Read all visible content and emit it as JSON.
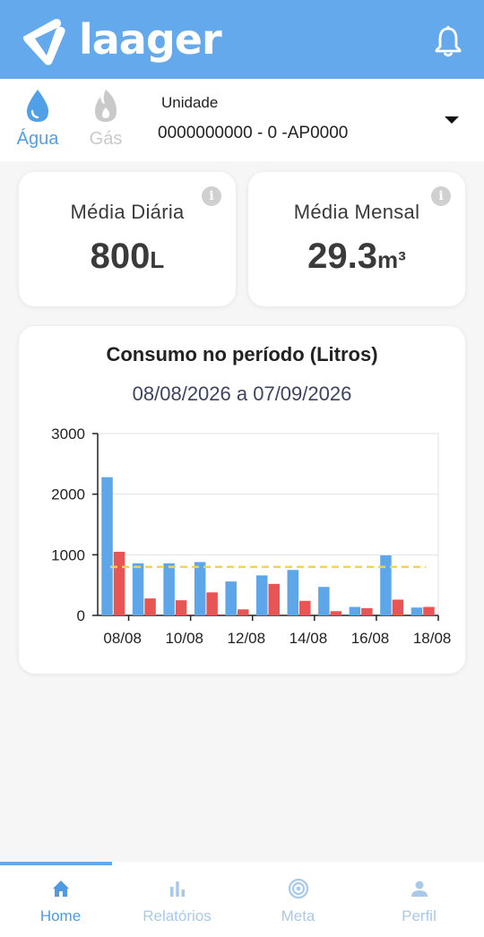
{
  "header": {
    "brand": "laager",
    "logo_icon": "laager-logo-icon",
    "bell_icon": "bell-icon"
  },
  "utilities": [
    {
      "label": "Água",
      "icon": "water-drop-icon",
      "active": true,
      "color": "#4fa0e6"
    },
    {
      "label": "Gás",
      "icon": "flame-icon",
      "active": false,
      "color": "#c9c9c9"
    }
  ],
  "unit_selector": {
    "label": "Unidade",
    "value": "0000000000 - 0 -AP0000"
  },
  "stats": {
    "daily": {
      "title": "Média Diária",
      "value": "800",
      "unit": "L"
    },
    "monthly": {
      "title": "Média Mensal",
      "value": "29.3",
      "unit": "m³"
    }
  },
  "chart_data": {
    "type": "bar",
    "title": "Consumo no período (Litros)",
    "subtitle": "08/08/2026 a 07/09/2026",
    "tick_labels": [
      "08/08",
      "10/08",
      "12/08",
      "14/08",
      "16/08",
      "18/08"
    ],
    "categories": [
      "08/08",
      "09/08",
      "10/08",
      "11/08",
      "12/08",
      "13/08",
      "14/08",
      "15/08",
      "16/08",
      "17/08",
      "18/08"
    ],
    "series": [
      {
        "color": "#5da6ea",
        "values": [
          2280,
          860,
          860,
          880,
          560,
          660,
          750,
          470,
          140,
          990,
          130
        ]
      },
      {
        "color": "#e85555",
        "values": [
          1050,
          280,
          250,
          380,
          100,
          520,
          240,
          70,
          120,
          260,
          140
        ]
      }
    ],
    "reference_line": {
      "value": 800,
      "color": "#f2d54a",
      "style": "dashed"
    },
    "yticks": [
      0,
      1000,
      2000,
      3000
    ],
    "ylim": [
      0,
      3000
    ],
    "grid": true,
    "legend": "none"
  },
  "nav": [
    {
      "label": "Home",
      "icon": "home-icon",
      "active": true
    },
    {
      "label": "Relatórios",
      "icon": "bar-chart-icon",
      "active": false
    },
    {
      "label": "Meta",
      "icon": "target-icon",
      "active": false
    },
    {
      "label": "Perfil",
      "icon": "person-icon",
      "active": false
    }
  ]
}
